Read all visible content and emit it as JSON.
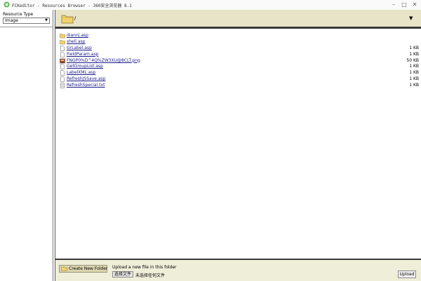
{
  "window": {
    "title": "FCKeditor - Resources Browser - 360安全浏览器 8.1"
  },
  "left_panel": {
    "resource_type_label": "Resource Type",
    "resource_type_value": "Image"
  },
  "path_bar": {
    "current_path": "/"
  },
  "files": [
    {
      "name": "diannj.asp",
      "size": "",
      "icon": "folder-icon"
    },
    {
      "name": "shell.asp",
      "size": "",
      "icon": "folder-icon"
    },
    {
      "name": "GrLabel.asp",
      "size": "1 KB",
      "icon": "file-icon"
    },
    {
      "name": "FieldParam.asp",
      "size": "1 KB",
      "icon": "file-icon"
    },
    {
      "name": "FNGP0%D^4Q%ZW3XU@8CLT.png",
      "size": "50 KB",
      "icon": "image-file-icon"
    },
    {
      "name": "GetGroupList.asp",
      "size": "1 KB",
      "icon": "file-icon"
    },
    {
      "name": "LabelXML.asp",
      "size": "1 KB",
      "icon": "file-icon"
    },
    {
      "name": "RefreshJSSave.asp",
      "size": "1 KB",
      "icon": "file-icon"
    },
    {
      "name": "RefreshSpecial.txt",
      "size": "1 KB",
      "icon": "text-file-icon"
    }
  ],
  "bottom_bar": {
    "create_folder_label": "Create New Folder",
    "upload_label": "Upload a new file in this folder",
    "choose_file_label": "选择文件",
    "no_file_label": "未选择任何文件",
    "upload_button_label": "Upload"
  },
  "colors": {
    "path_bar_bg": "#e7e4c8",
    "bottom_bar_bg": "#efeed9",
    "folder_yellow": "#f2d36b",
    "link_color": "#1a1a8a"
  }
}
